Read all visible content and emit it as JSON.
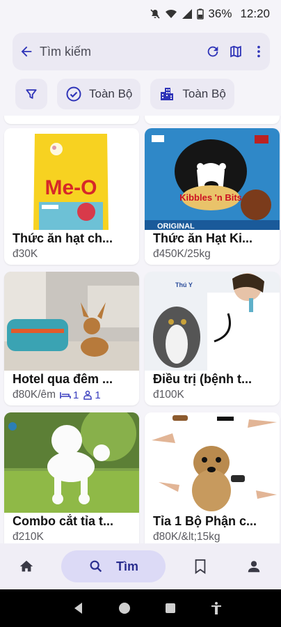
{
  "status": {
    "battery": "36%",
    "time": "12:20"
  },
  "search": {
    "placeholder": "Tìm kiếm"
  },
  "filters": [
    {
      "label": "Toàn Bộ",
      "icon": "check-circle-icon"
    },
    {
      "label": "Toàn Bộ",
      "icon": "buildings-icon"
    }
  ],
  "products": [
    {
      "title": "Thức ăn hạt ch...",
      "price": "đ30K"
    },
    {
      "title": "Thức ăn Hạt Ki...",
      "price": "đ450K/25kg"
    },
    {
      "title": "Hotel qua đêm ...",
      "price": "đ80K/êm",
      "beds": "1",
      "guests": "1"
    },
    {
      "title": "Điều trị (bệnh t...",
      "price": "đ100K"
    },
    {
      "title": "Combo cắt tỉa t...",
      "price": "đ210K"
    },
    {
      "title": "Tỉa 1 Bộ Phận c...",
      "price": "đ80K/&lt;15kg"
    }
  ],
  "image_text": {
    "brand_meo": "Me-O",
    "brand_kibbles": "Kibbles 'n Bits",
    "kibbles_original": "ORIGINAL",
    "vet_logo": "Thú Y"
  },
  "nav": {
    "search_label": "Tìm"
  },
  "colors": {
    "accent": "#2f34b8",
    "pill": "#dcdaf6",
    "surface": "#ebe9f3"
  }
}
